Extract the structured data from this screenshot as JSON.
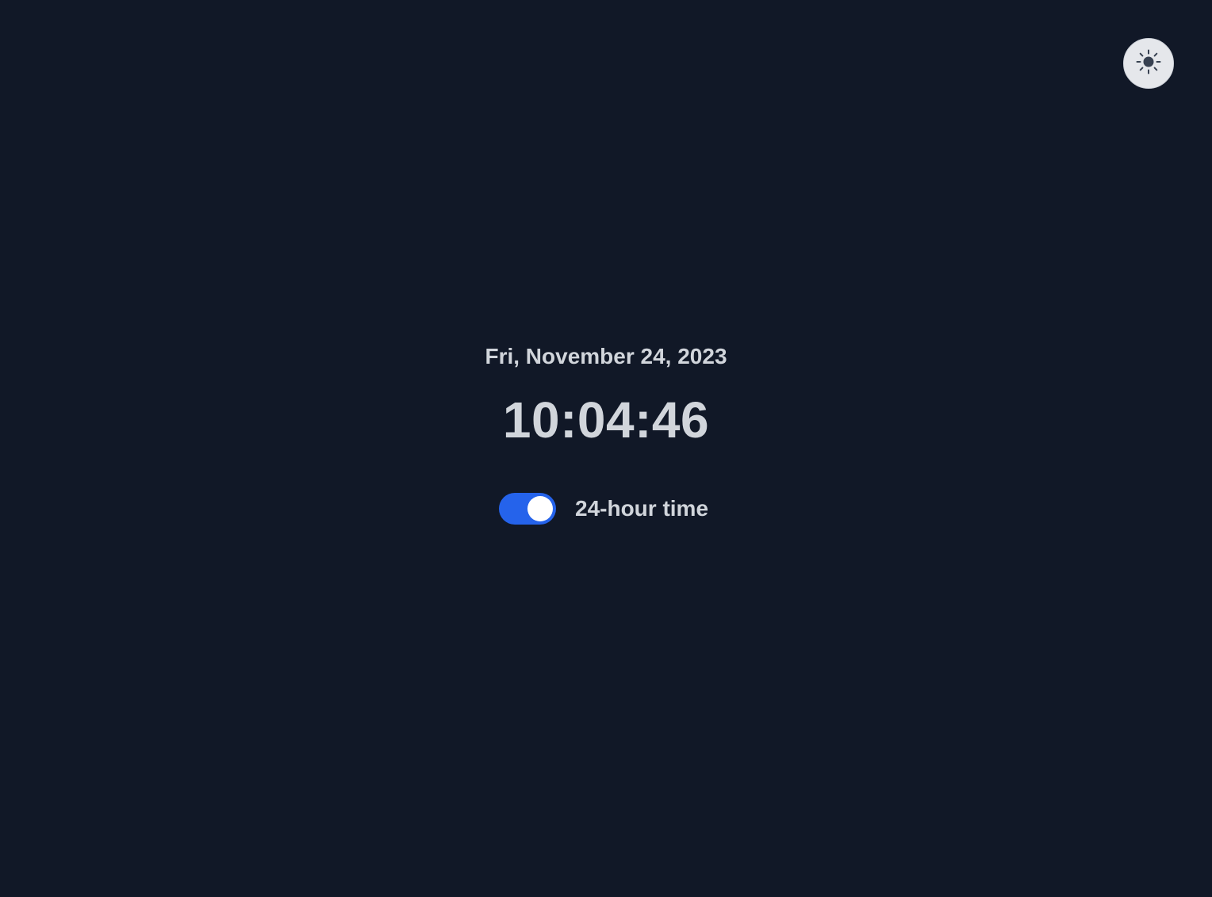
{
  "theme_button": {
    "icon": "sun-icon",
    "background_color": "#e5e7eb",
    "icon_color": "#374151"
  },
  "clock": {
    "date": "Fri, November 24, 2023",
    "time": "10:04:46"
  },
  "hour_format_toggle": {
    "label": "24-hour time",
    "checked": true,
    "accent_color": "#2563eb"
  },
  "colors": {
    "background": "#111827",
    "text": "#d1d5db"
  }
}
